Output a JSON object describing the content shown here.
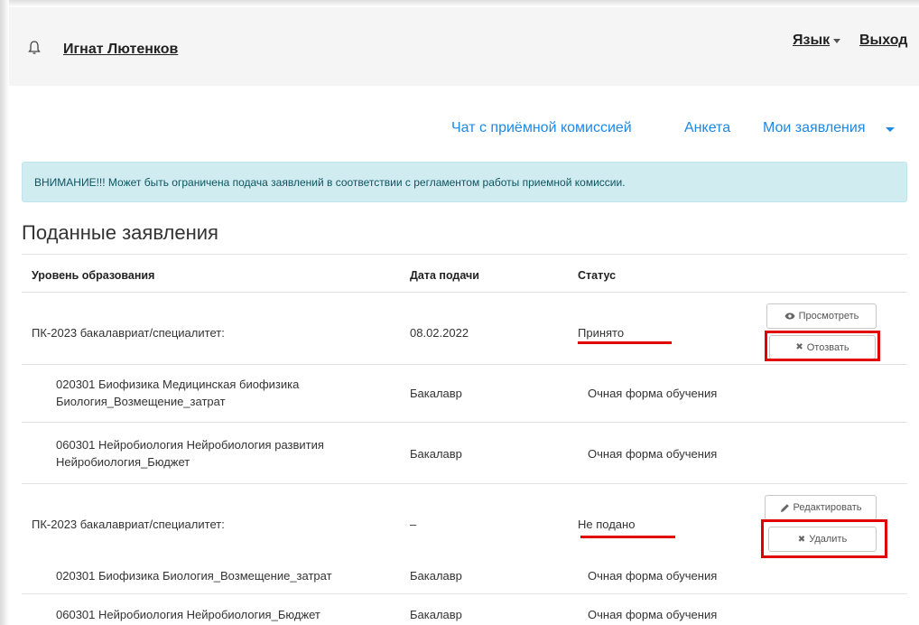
{
  "header": {
    "user_name": "Игнат Лютенков",
    "lang_label": "Язык",
    "exit_label": "Выход"
  },
  "nav": {
    "chat": "Чат с приёмной комиссией",
    "form": "Анкета",
    "applications": "Мои заявления"
  },
  "alert": {
    "text": "ВНИМАНИЕ!!! Может быть ограничена подача заявлений в соответствии с регламентом работы приемной комиссии."
  },
  "page": {
    "title": "Поданные заявления"
  },
  "table": {
    "headers": [
      "Уровень образования",
      "Дата подачи",
      "Статус"
    ],
    "applications": [
      {
        "title": "ПК-2023 бакалавриат/специалитет:",
        "date": "08.02.2022",
        "status": "Принято",
        "buttons": [
          "Просмотреть",
          "Отозвать"
        ],
        "programs": [
          {
            "name_line1": "020301 Биофизика Медицинская биофизика",
            "name_line2": "Биология_Возмещение_затрат",
            "level": "Бакалавр",
            "form": "Очная форма обучения"
          },
          {
            "name_line1": "060301 Нейробиология Нейробиология развития",
            "name_line2": "Нейробиология_Бюджет",
            "level": "Бакалавр",
            "form": "Очная форма обучения"
          }
        ]
      },
      {
        "title": "ПК-2023 бакалавриат/специалитет:",
        "date": "–",
        "status": "Не подано",
        "buttons": [
          "Редактировать",
          "Удалить"
        ],
        "programs": [
          {
            "name_line1": "020301 Биофизика Биология_Возмещение_затрат",
            "level": "Бакалавр",
            "form": "Очная форма обучения"
          },
          {
            "name_line1": "060301 Нейробиология Нейробиология_Бюджет",
            "level": "Бакалавр",
            "form": "Очная форма обучения"
          }
        ]
      }
    ]
  },
  "icons": {
    "bell": "bell-icon",
    "view": "eye-icon",
    "withdraw": "x-icon",
    "edit": "pencil-icon",
    "delete": "x-icon"
  },
  "colors": {
    "link": "#1e88e5",
    "alert_bg": "#d1ecf1",
    "alert_text": "#0c5460",
    "highlight": "#e00000"
  }
}
